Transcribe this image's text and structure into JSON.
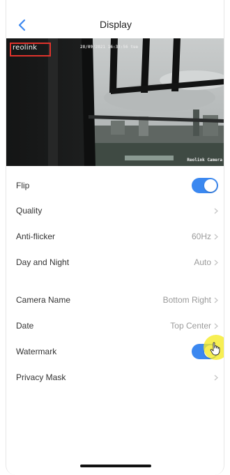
{
  "header": {
    "title": "Display",
    "back_icon": "chevron-left-icon"
  },
  "preview": {
    "logo_text": "reolink",
    "date_text": "28/09/2021 16:33:56 tue",
    "camera_name_text": "Reolink Camera"
  },
  "settings": [
    {
      "label": "Flip",
      "type": "toggle",
      "on": true
    },
    {
      "label": "Quality",
      "type": "link",
      "value": ""
    },
    {
      "label": "Anti-flicker",
      "type": "link",
      "value": "60Hz"
    },
    {
      "label": "Day and Night",
      "type": "link",
      "value": "Auto"
    },
    {
      "label": "Camera Name",
      "type": "link",
      "value": "Bottom Right"
    },
    {
      "label": "Date",
      "type": "link",
      "value": "Top Center"
    },
    {
      "label": "Watermark",
      "type": "toggle",
      "on": true
    },
    {
      "label": "Privacy Mask",
      "type": "link",
      "value": ""
    }
  ],
  "colors": {
    "accent": "#3b88f0",
    "osd_box": "#e0332c",
    "tap_highlight": "#f5eb28"
  }
}
